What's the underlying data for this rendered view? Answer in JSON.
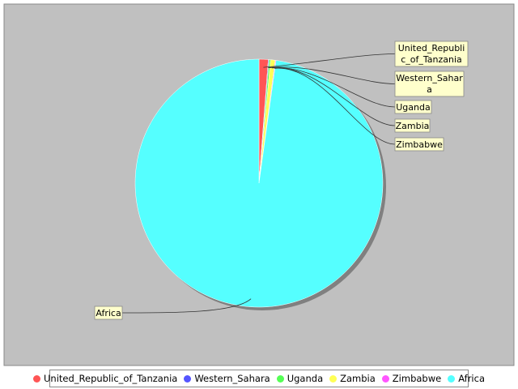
{
  "chart_data": {
    "type": "pie",
    "categories": [
      "United_Republic_of_Tanzania",
      "Western_Sahara",
      "Uganda",
      "Zambia",
      "Zimbabwe",
      "Africa"
    ],
    "values": [
      1.2,
      0.1,
      0.2,
      0.6,
      0.1,
      97.8
    ],
    "colors": [
      "#ff5555",
      "#5555ff",
      "#55ff55",
      "#ffff55",
      "#ff55ff",
      "#55ffff"
    ],
    "slice_labels": [
      [
        "United_Republi",
        "c_of_Tanzania"
      ],
      [
        "Western_Sahar",
        "a"
      ],
      [
        "Uganda"
      ],
      [
        "Zambia"
      ],
      [
        "Zimbabwe"
      ],
      [
        "Africa"
      ]
    ],
    "title": "",
    "legend_position": "bottom",
    "plot_background": "#c0c0c0",
    "label_background": "#ffffcc"
  }
}
